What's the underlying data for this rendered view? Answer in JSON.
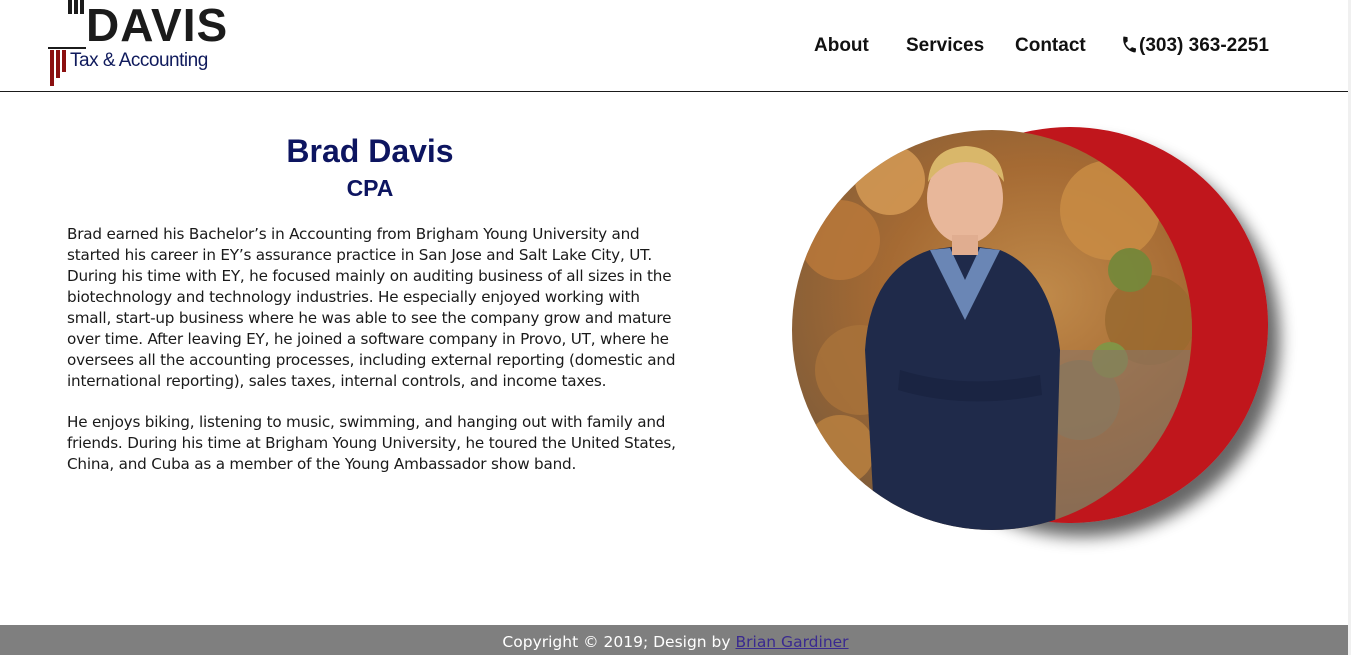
{
  "brand": {
    "name": "DAVIS",
    "tagline": "Tax & Accounting",
    "colors": {
      "dark": "#1b1b1b",
      "red": "#8b1010",
      "navy": "#0d1560"
    }
  },
  "nav": {
    "items": [
      {
        "label": "About"
      },
      {
        "label": "Services"
      },
      {
        "label": "Contact"
      }
    ],
    "phone": {
      "icon": "phone-icon",
      "number": "(303) 363-2251"
    }
  },
  "profile": {
    "name": "Brad Davis",
    "credential": "CPA",
    "bio": [
      "Brad earned his Bachelor’s in Accounting from Brigham Young University and started his career in EY’s assurance practice in San Jose and Salt Lake City, UT. During his time with EY, he focused mainly on auditing business of all sizes in the biotechnology and technology industries. He especially enjoyed working with small, start-up business where he was able to see the company grow and mature over time. After leaving EY, he joined a software company in Provo, UT, where he oversees all the accounting processes, including external reporting (domestic and international reporting), sales taxes, internal controls, and income taxes.",
      "He enjoys biking, listening to music, swimming, and hanging out with family and friends. During his time at Brigham Young University, he toured the United States, China, and Cuba as a member of the Young Ambassador show band."
    ],
    "accent_color": "#c0121a"
  },
  "footer": {
    "text": "Copyright © 2019; Design by ",
    "link_label": "Brian Gardiner"
  }
}
